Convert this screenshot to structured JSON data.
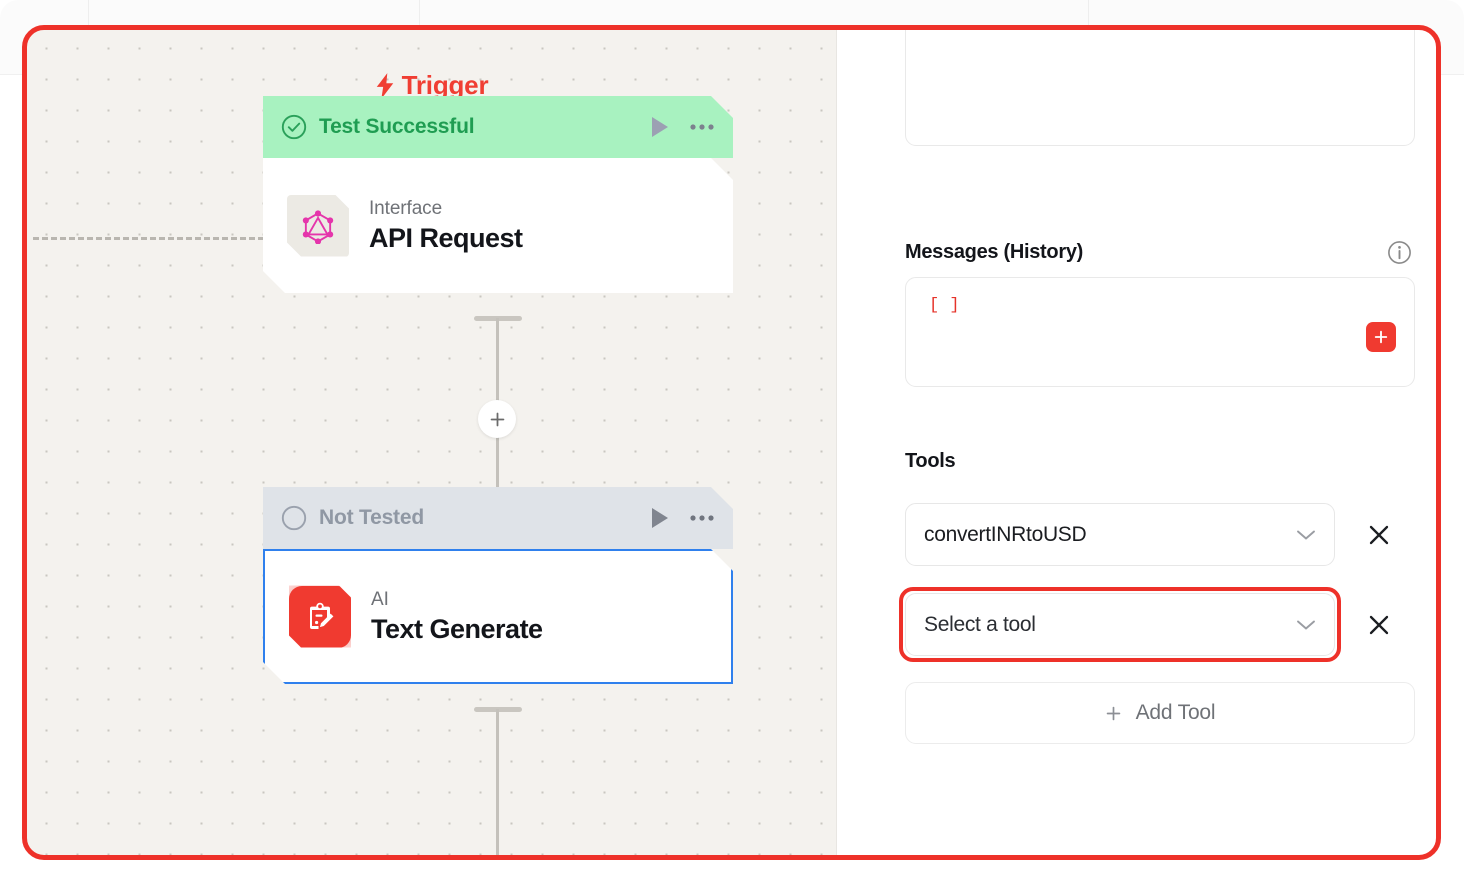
{
  "canvas": {
    "trigger_label": "Trigger",
    "trigger_icon": "lightning-bolt-icon",
    "nodes": [
      {
        "status_label": "Test Successful",
        "status_icon": "check-circle-icon",
        "kind": "Interface",
        "title": "API Request",
        "icon": "graphql-icon",
        "selected": false,
        "run_icon": "play-icon",
        "menu_icon": "ellipsis-icon"
      },
      {
        "status_label": "Not Tested",
        "status_icon": "empty-circle-icon",
        "kind": "AI",
        "title": "Text Generate",
        "icon": "ai-clipboard-pencil-icon",
        "selected": true,
        "run_icon": "play-icon",
        "menu_icon": "ellipsis-icon"
      }
    ],
    "add_node_icon": "plus-icon"
  },
  "panel": {
    "messages": {
      "label": "Messages (History)",
      "info_icon": "info-icon",
      "value": "[ ]",
      "add_icon": "plus-icon"
    },
    "tools": {
      "label": "Tools",
      "rows": [
        {
          "value": "convertINRtoUSD",
          "chevron_icon": "chevron-down-icon",
          "remove_icon": "close-icon",
          "highlighted": false
        },
        {
          "value": "Select a tool",
          "chevron_icon": "chevron-down-icon",
          "remove_icon": "close-icon",
          "highlighted": true
        }
      ],
      "add_label": "Add Tool",
      "add_icon": "plus-icon"
    }
  },
  "colors": {
    "accent_red": "#ee3129",
    "success_green": "#a8f2c0",
    "success_text": "#1f9d52",
    "untested_grey": "#dfe3e8",
    "selection_blue": "#2f80ed",
    "canvas_bg": "#f4f2ee",
    "graphql_pink": "#e535ab"
  }
}
